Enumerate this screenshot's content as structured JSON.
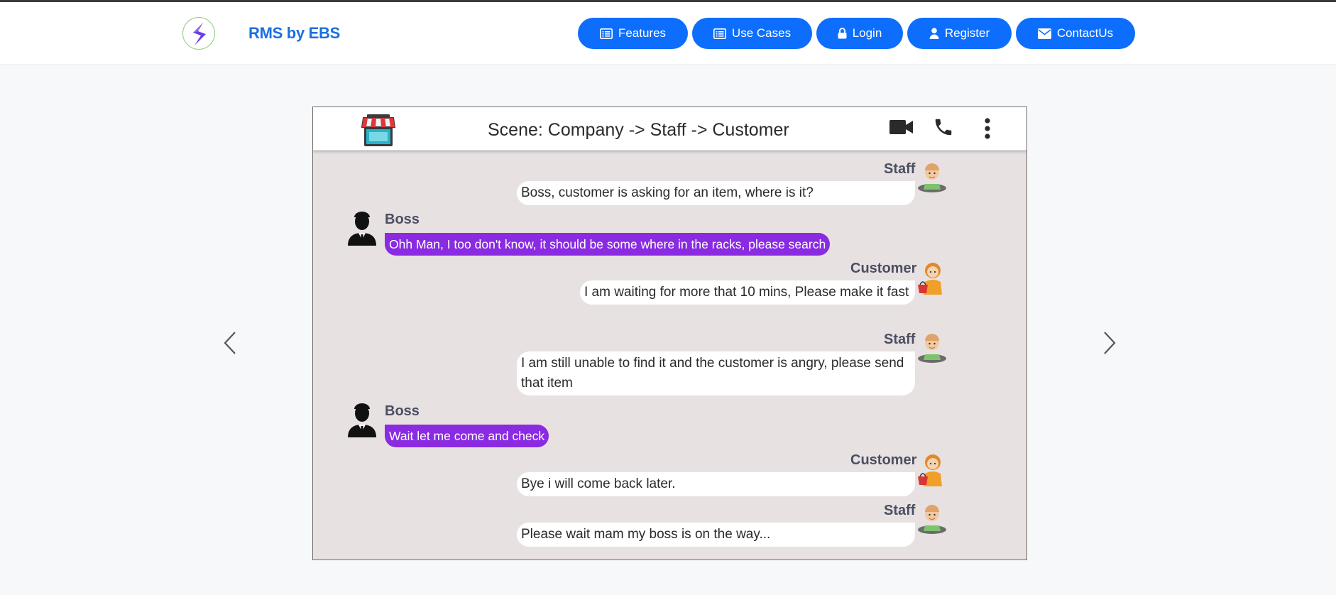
{
  "brand": {
    "name": "RMS by EBS",
    "logo_icon": "lightning-s-logo-icon"
  },
  "nav": [
    {
      "label": "Features",
      "icon": "list-icon"
    },
    {
      "label": "Use Cases",
      "icon": "list-icon"
    },
    {
      "label": "Login",
      "icon": "lock-icon"
    },
    {
      "label": "Register",
      "icon": "user-icon"
    },
    {
      "label": "ContactUs",
      "icon": "envelope-icon"
    }
  ],
  "colors": {
    "nav_button": "#0d6efd",
    "brand": "#1a6fe0",
    "boss_bubble": "#8a2be2",
    "chat_bg": "#e8e1e1"
  },
  "carousel": {
    "prev_icon": "chevron-left-icon",
    "next_icon": "chevron-right-icon"
  },
  "chat": {
    "title": "Scene: Company -> Staff -> Customer",
    "header_icons": [
      "shop-icon",
      "video-camera-icon",
      "phone-icon",
      "more-vertical-icon"
    ],
    "messages": [
      {
        "sender": "Staff",
        "side": "right",
        "text": "Boss, customer is asking for an item, where is it?"
      },
      {
        "sender": "Boss",
        "side": "left",
        "text": "Ohh Man, I too don't know, it should be some where in the racks, please search"
      },
      {
        "sender": "Customer",
        "side": "right",
        "text": "I am waiting for more that 10 mins, Please make it fast"
      },
      {
        "sender": "Staff",
        "side": "right",
        "text": "I am still unable to find it and the customer is angry, please send that item"
      },
      {
        "sender": "Boss",
        "side": "left",
        "text": "Wait let me come and check"
      },
      {
        "sender": "Customer",
        "side": "right",
        "text": "Bye i will come back later."
      },
      {
        "sender": "Staff",
        "side": "right",
        "text": "Please wait mam my boss is on the way..."
      }
    ]
  }
}
